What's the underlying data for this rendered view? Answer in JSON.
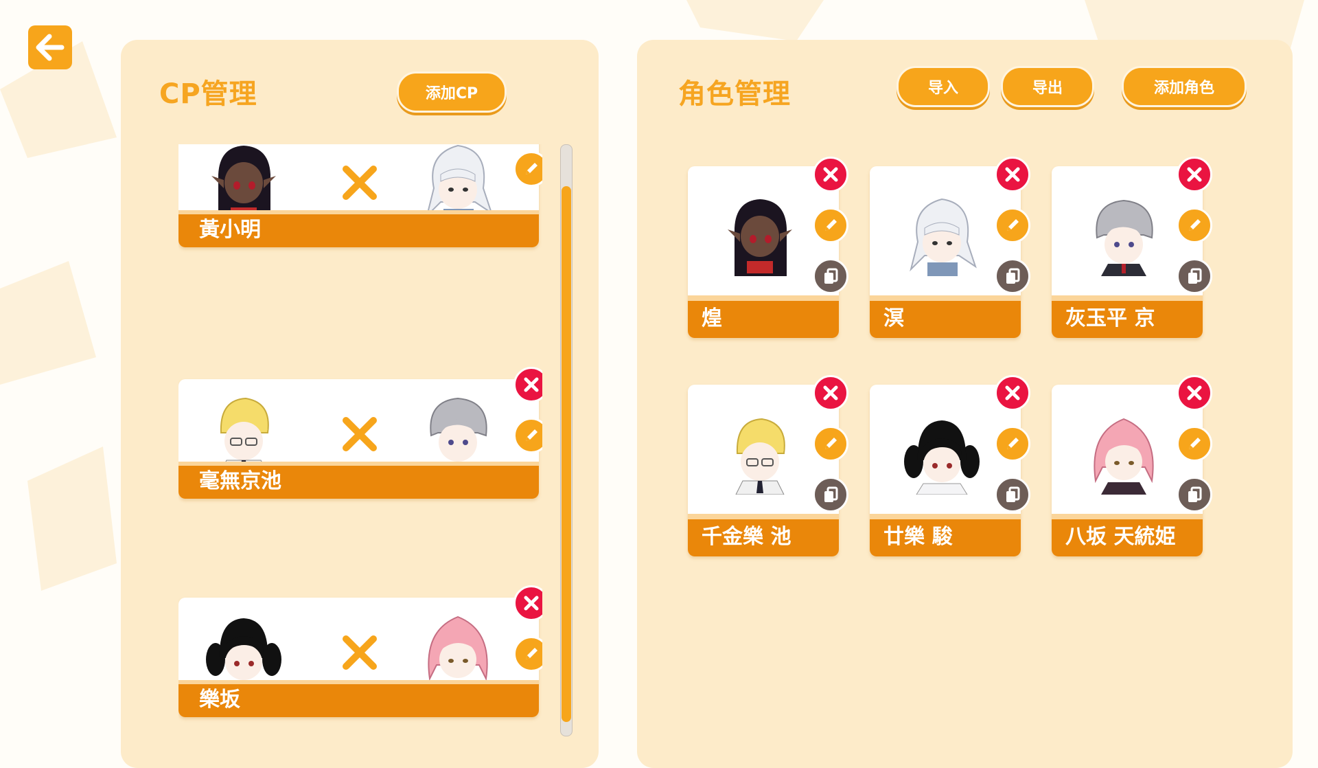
{
  "app": {
    "back_icon": "arrow-left-icon"
  },
  "colors": {
    "accent": "#f7a51b",
    "bar": "#ea870a",
    "delete": "#ea1441",
    "copy": "#6d5d57",
    "panel": "#fdebc9"
  },
  "cp_panel": {
    "title": "CP管理",
    "add_label": "添加CP",
    "items": [
      {
        "name": "黃小明",
        "left": "dark-skin-elf",
        "right": "white-hair-boy"
      },
      {
        "name": "毫無京池",
        "left": "blonde-glasses",
        "right": "gray-hair-boy"
      },
      {
        "name": "樂坂",
        "left": "black-twintail-girl",
        "right": "pink-hair-boy"
      }
    ]
  },
  "char_panel": {
    "title": "角色管理",
    "import_label": "导入",
    "export_label": "导出",
    "add_label": "添加角色",
    "items": [
      {
        "name": "煌",
        "avatar": "dark-skin-elf"
      },
      {
        "name": "溟",
        "avatar": "white-hair-boy"
      },
      {
        "name": "灰玉平 京",
        "avatar": "gray-hair-boy"
      },
      {
        "name": "千金樂 池",
        "avatar": "blonde-glasses"
      },
      {
        "name": "廿樂 駿",
        "avatar": "black-twintail-girl"
      },
      {
        "name": "八坂 天統姫",
        "avatar": "pink-hair-boy"
      }
    ]
  }
}
